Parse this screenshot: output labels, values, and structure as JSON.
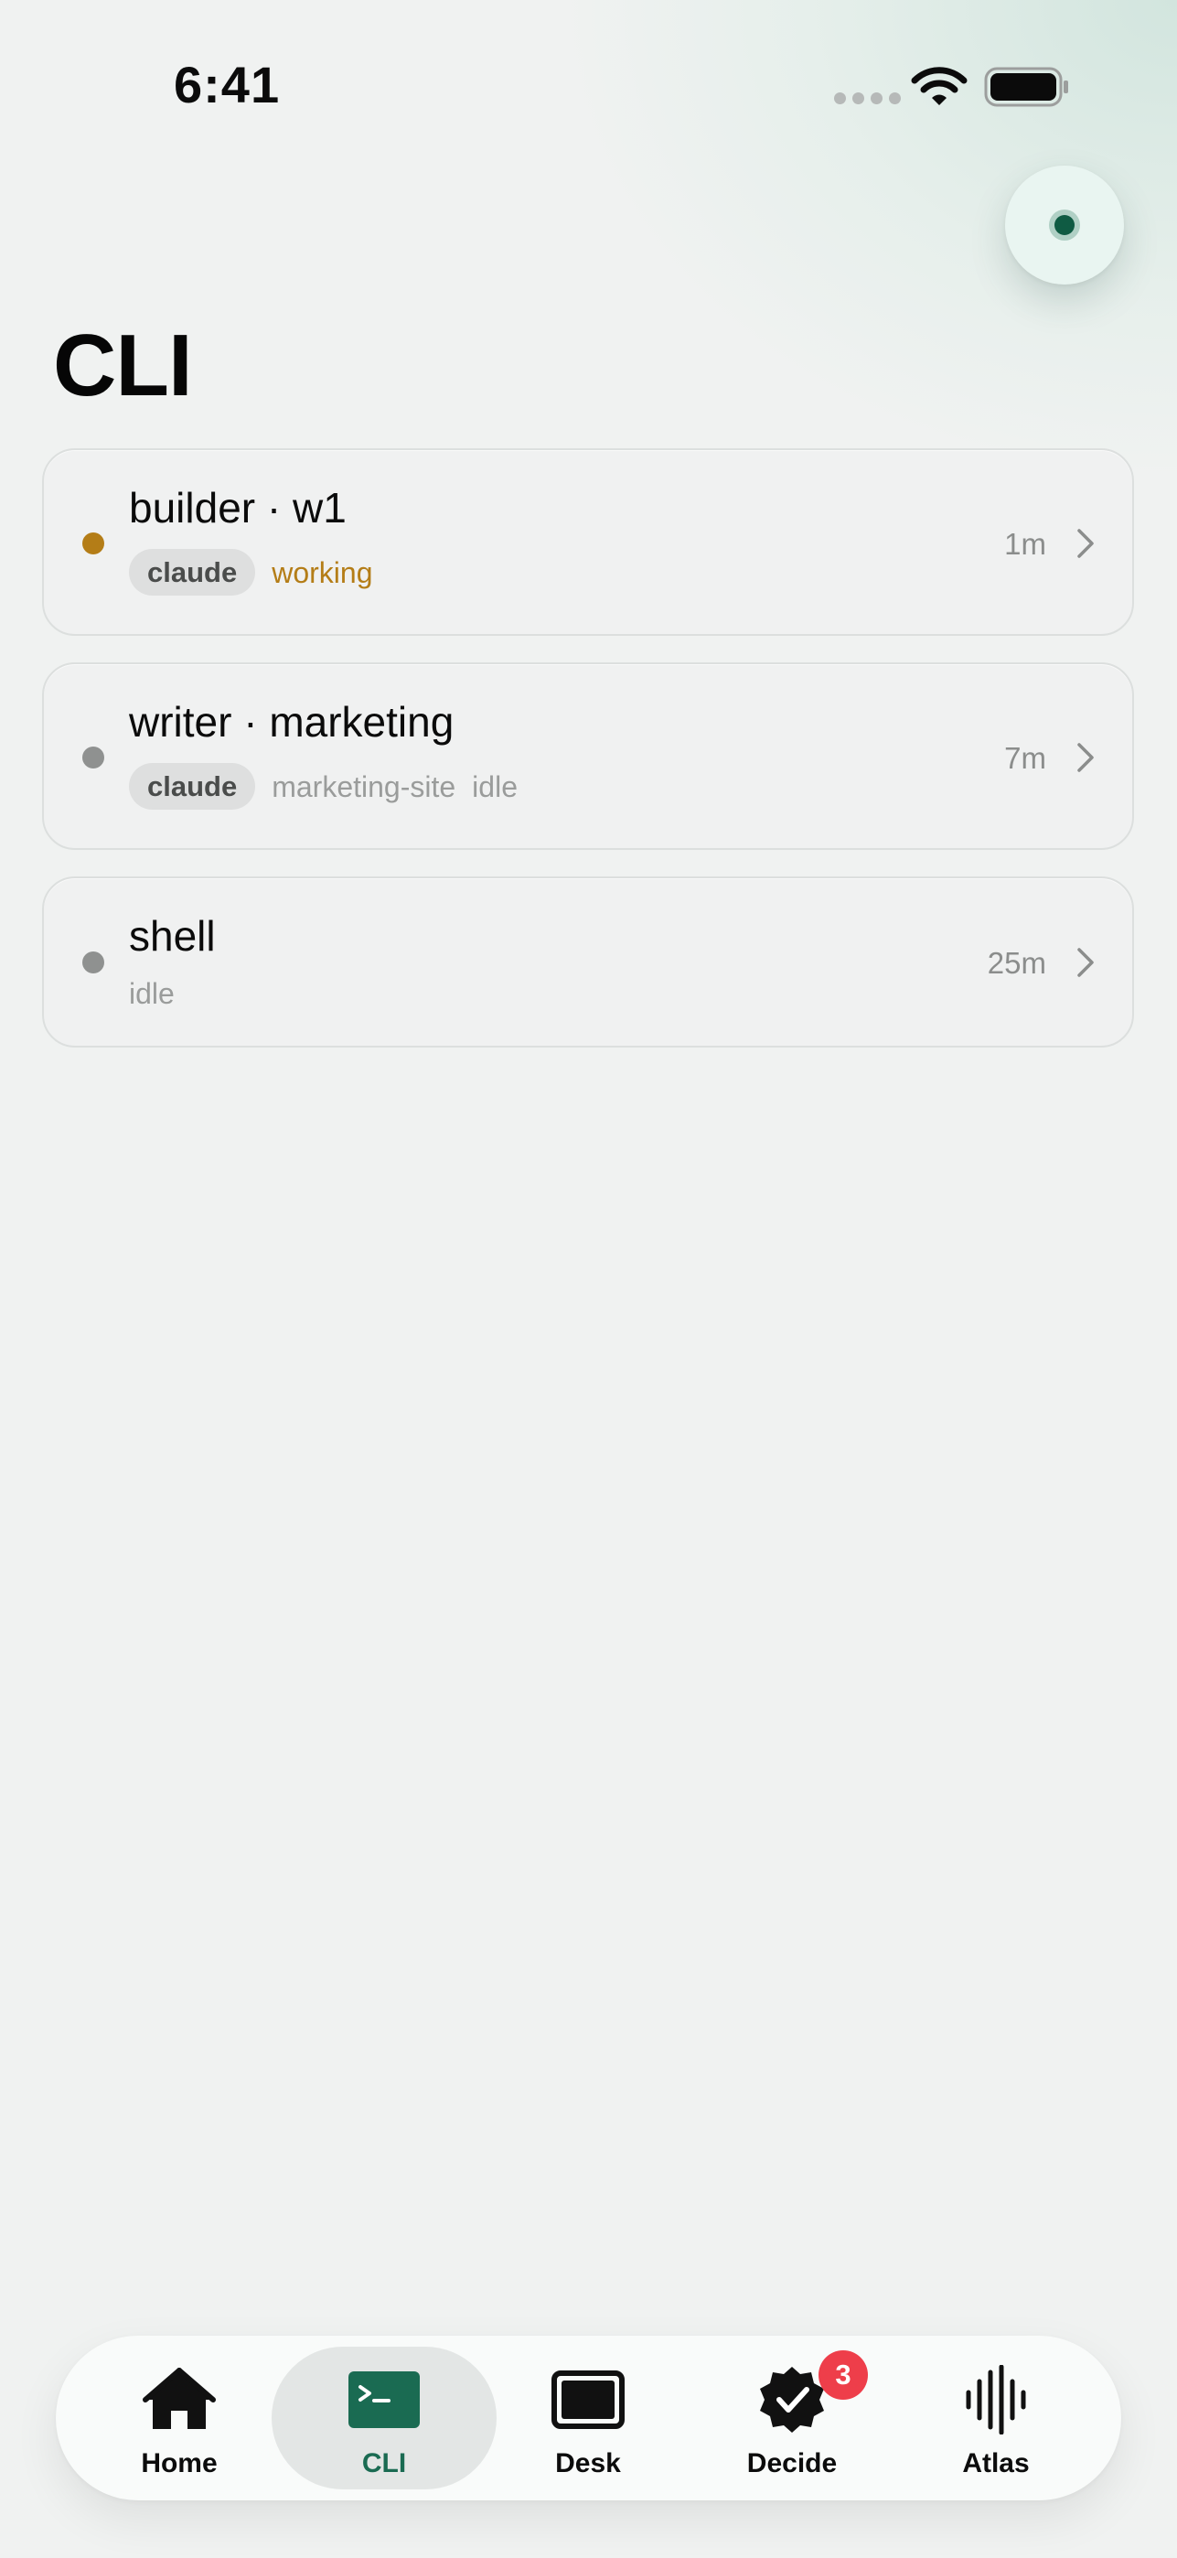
{
  "status_bar": {
    "time": "6:41"
  },
  "header": {
    "title": "CLI"
  },
  "sessions": [
    {
      "title": "builder · w1",
      "chip": "claude",
      "meta": [
        "working"
      ],
      "status": "working",
      "status_color": "#b47d17",
      "time": "1m"
    },
    {
      "title": "writer · marketing",
      "chip": "claude",
      "meta": [
        "marketing-site",
        "idle"
      ],
      "status": "idle",
      "status_color": "#8f9190",
      "time": "7m"
    },
    {
      "title": "shell",
      "meta": [
        "idle"
      ],
      "status": "idle",
      "status_color": "#8f9190",
      "time": "25m"
    }
  ],
  "tab_bar": {
    "tabs": [
      {
        "label": "Home",
        "icon": "home-icon"
      },
      {
        "label": "CLI",
        "icon": "terminal-icon",
        "active": true
      },
      {
        "label": "Desk",
        "icon": "monitor-icon"
      },
      {
        "label": "Decide",
        "icon": "check-badge-icon",
        "badge": "3"
      },
      {
        "label": "Atlas",
        "icon": "waveform-icon"
      }
    ]
  },
  "colors": {
    "accent": "#1a6b52",
    "working": "#b47d17",
    "idle": "#8f9190",
    "badge": "#ee3e4a"
  }
}
